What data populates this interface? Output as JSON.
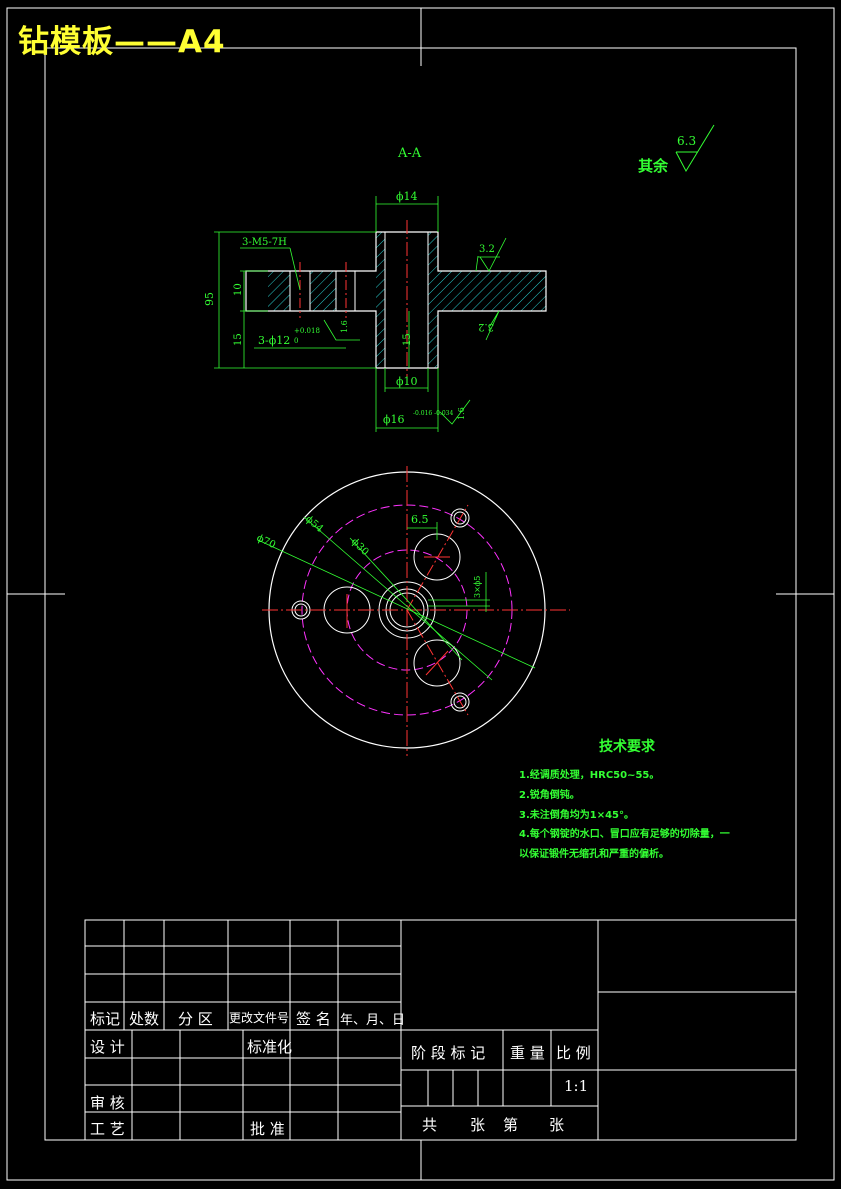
{
  "title": "钻模板——A4",
  "section_label": "A-A",
  "roughness_rest": {
    "label": "其余",
    "value": "6.3"
  },
  "dims": {
    "d14": "ϕ14",
    "m5": "3-M5-7H",
    "h95": "95",
    "h10": "10",
    "h15a": "15",
    "h15b": "15",
    "d12": "3-ϕ12",
    "d12_exp": "+0.018",
    "d12_sub": "0",
    "d10": "ϕ10",
    "d16": "ϕ16",
    "d16_tol": "-0.016 -0.034",
    "r32a": "3.2",
    "r32b": "3.2",
    "r16a": "1.6",
    "r16b": "1.6",
    "d70": "ϕ70",
    "d54": "ϕ54",
    "d30": "ϕ30",
    "w65": "6.5",
    "t1": "3×ϕ5"
  },
  "tech": {
    "title": "技术要求",
    "lines": [
      "1.经调质处理，HRC50~55。",
      "2.锐角倒钝。",
      "3.未注倒角均为1×45°。",
      "4.每个钢锭的水口、冒口应有足够的切除量，一",
      "以保证锻件无缩孔和严重的偏析。"
    ]
  },
  "titleblock": {
    "mark": "标记",
    "count": "处数",
    "zone": "分 区",
    "change_doc": "更改文件号",
    "sign": "签 名",
    "date": "年、月、日",
    "design": "设 计",
    "standard": "标准化",
    "stage": "阶 段 标 记",
    "weight": "重 量",
    "scale": "比 例",
    "scale_value": "1:1",
    "review": "审 核",
    "process": "工 艺",
    "approve": "批 准",
    "total": "共",
    "sheets": "张",
    "nth": "第",
    "sheet": "张"
  },
  "colors": {
    "frame": "#ffffff",
    "dim": "#33ff33",
    "hatch": "#33ffff",
    "center": "#ff3333",
    "pitch": "#ff33ff",
    "title": "#ffff33"
  }
}
